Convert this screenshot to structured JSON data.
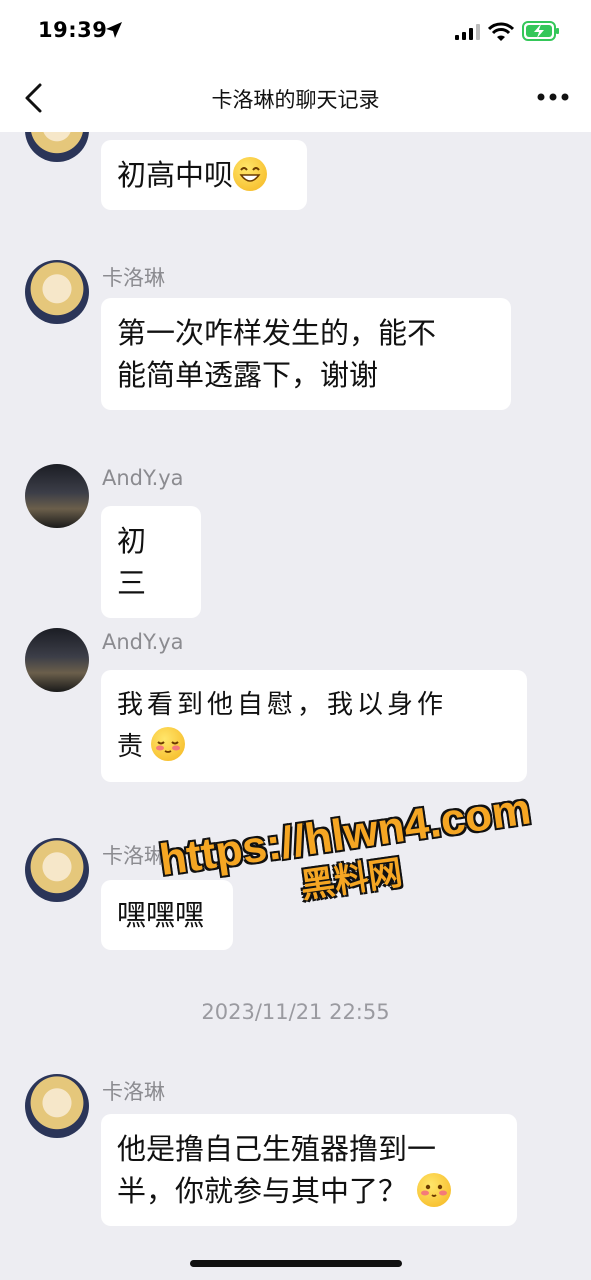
{
  "status_bar": {
    "time": "19:39",
    "icons": [
      "location-arrow-icon",
      "cellular-signal-icon",
      "wifi-icon",
      "battery-charging-icon"
    ],
    "battery_color": "#34c759"
  },
  "nav": {
    "title": "卡洛琳的聊天记录",
    "back_icon": "chevron-left-icon",
    "more_icon": "more-dots-icon"
  },
  "messages": [
    {
      "sender": "",
      "avatar": "girl-avatar",
      "text": "初高中呗",
      "emoji": "grinning-emoji"
    },
    {
      "sender": "卡洛琳",
      "avatar": "girl-avatar",
      "lines": [
        "第一次咋样发生的，能不",
        "能简单透露下，谢谢"
      ]
    },
    {
      "sender": "AndY.ya",
      "avatar": "city-avatar",
      "text": "初三"
    },
    {
      "sender": "AndY.ya",
      "avatar": "city-avatar",
      "lines": [
        "我看到他自慰，我以身作",
        "责"
      ],
      "emoji": "shy-emoji"
    },
    {
      "sender": "卡洛琳",
      "avatar": "girl-avatar",
      "text": "嘿嘿嘿"
    },
    {
      "sender": "卡洛琳",
      "avatar": "girl-avatar",
      "lines": [
        "他是撸自己生殖器撸到一",
        "半，你就参与其中了？"
      ],
      "emoji": "blush-emoji"
    }
  ],
  "timestamp": "2023/11/21 22:55",
  "watermark": {
    "url": "https://hlwn4.com",
    "subtitle": "黑料网",
    "color": "#f5a623"
  }
}
